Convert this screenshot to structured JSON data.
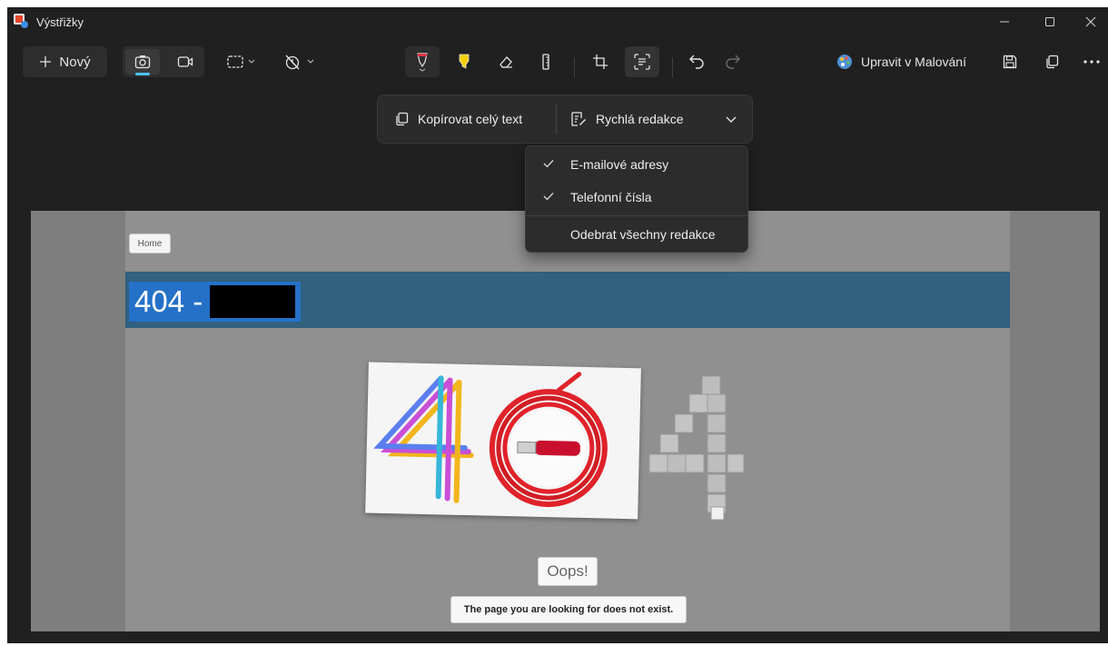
{
  "window": {
    "title": "Výstřižky"
  },
  "toolbar": {
    "new_label": "Nový",
    "paint_label": "Upravit v Malování"
  },
  "text_actions": {
    "copy_all_label": "Kopírovat celý text",
    "quick_redact_label": "Rychlá redakce"
  },
  "redact_menu": {
    "items": [
      {
        "label": "E-mailové adresy",
        "checked": true
      },
      {
        "label": "Telefonní čísla",
        "checked": true
      },
      {
        "label": "Odebrat všechny redakce",
        "checked": false
      }
    ]
  },
  "screenshot": {
    "home_link": "Home",
    "heading": "404 -",
    "oops": "Oops!",
    "message": "The page you are looking for does not exist."
  },
  "colors": {
    "accent": "#4cc2ff",
    "banner": "#32607f",
    "heading_bg": "#2571c8",
    "pen_red": "#e63946",
    "highlighter_yellow": "#f5d000"
  }
}
